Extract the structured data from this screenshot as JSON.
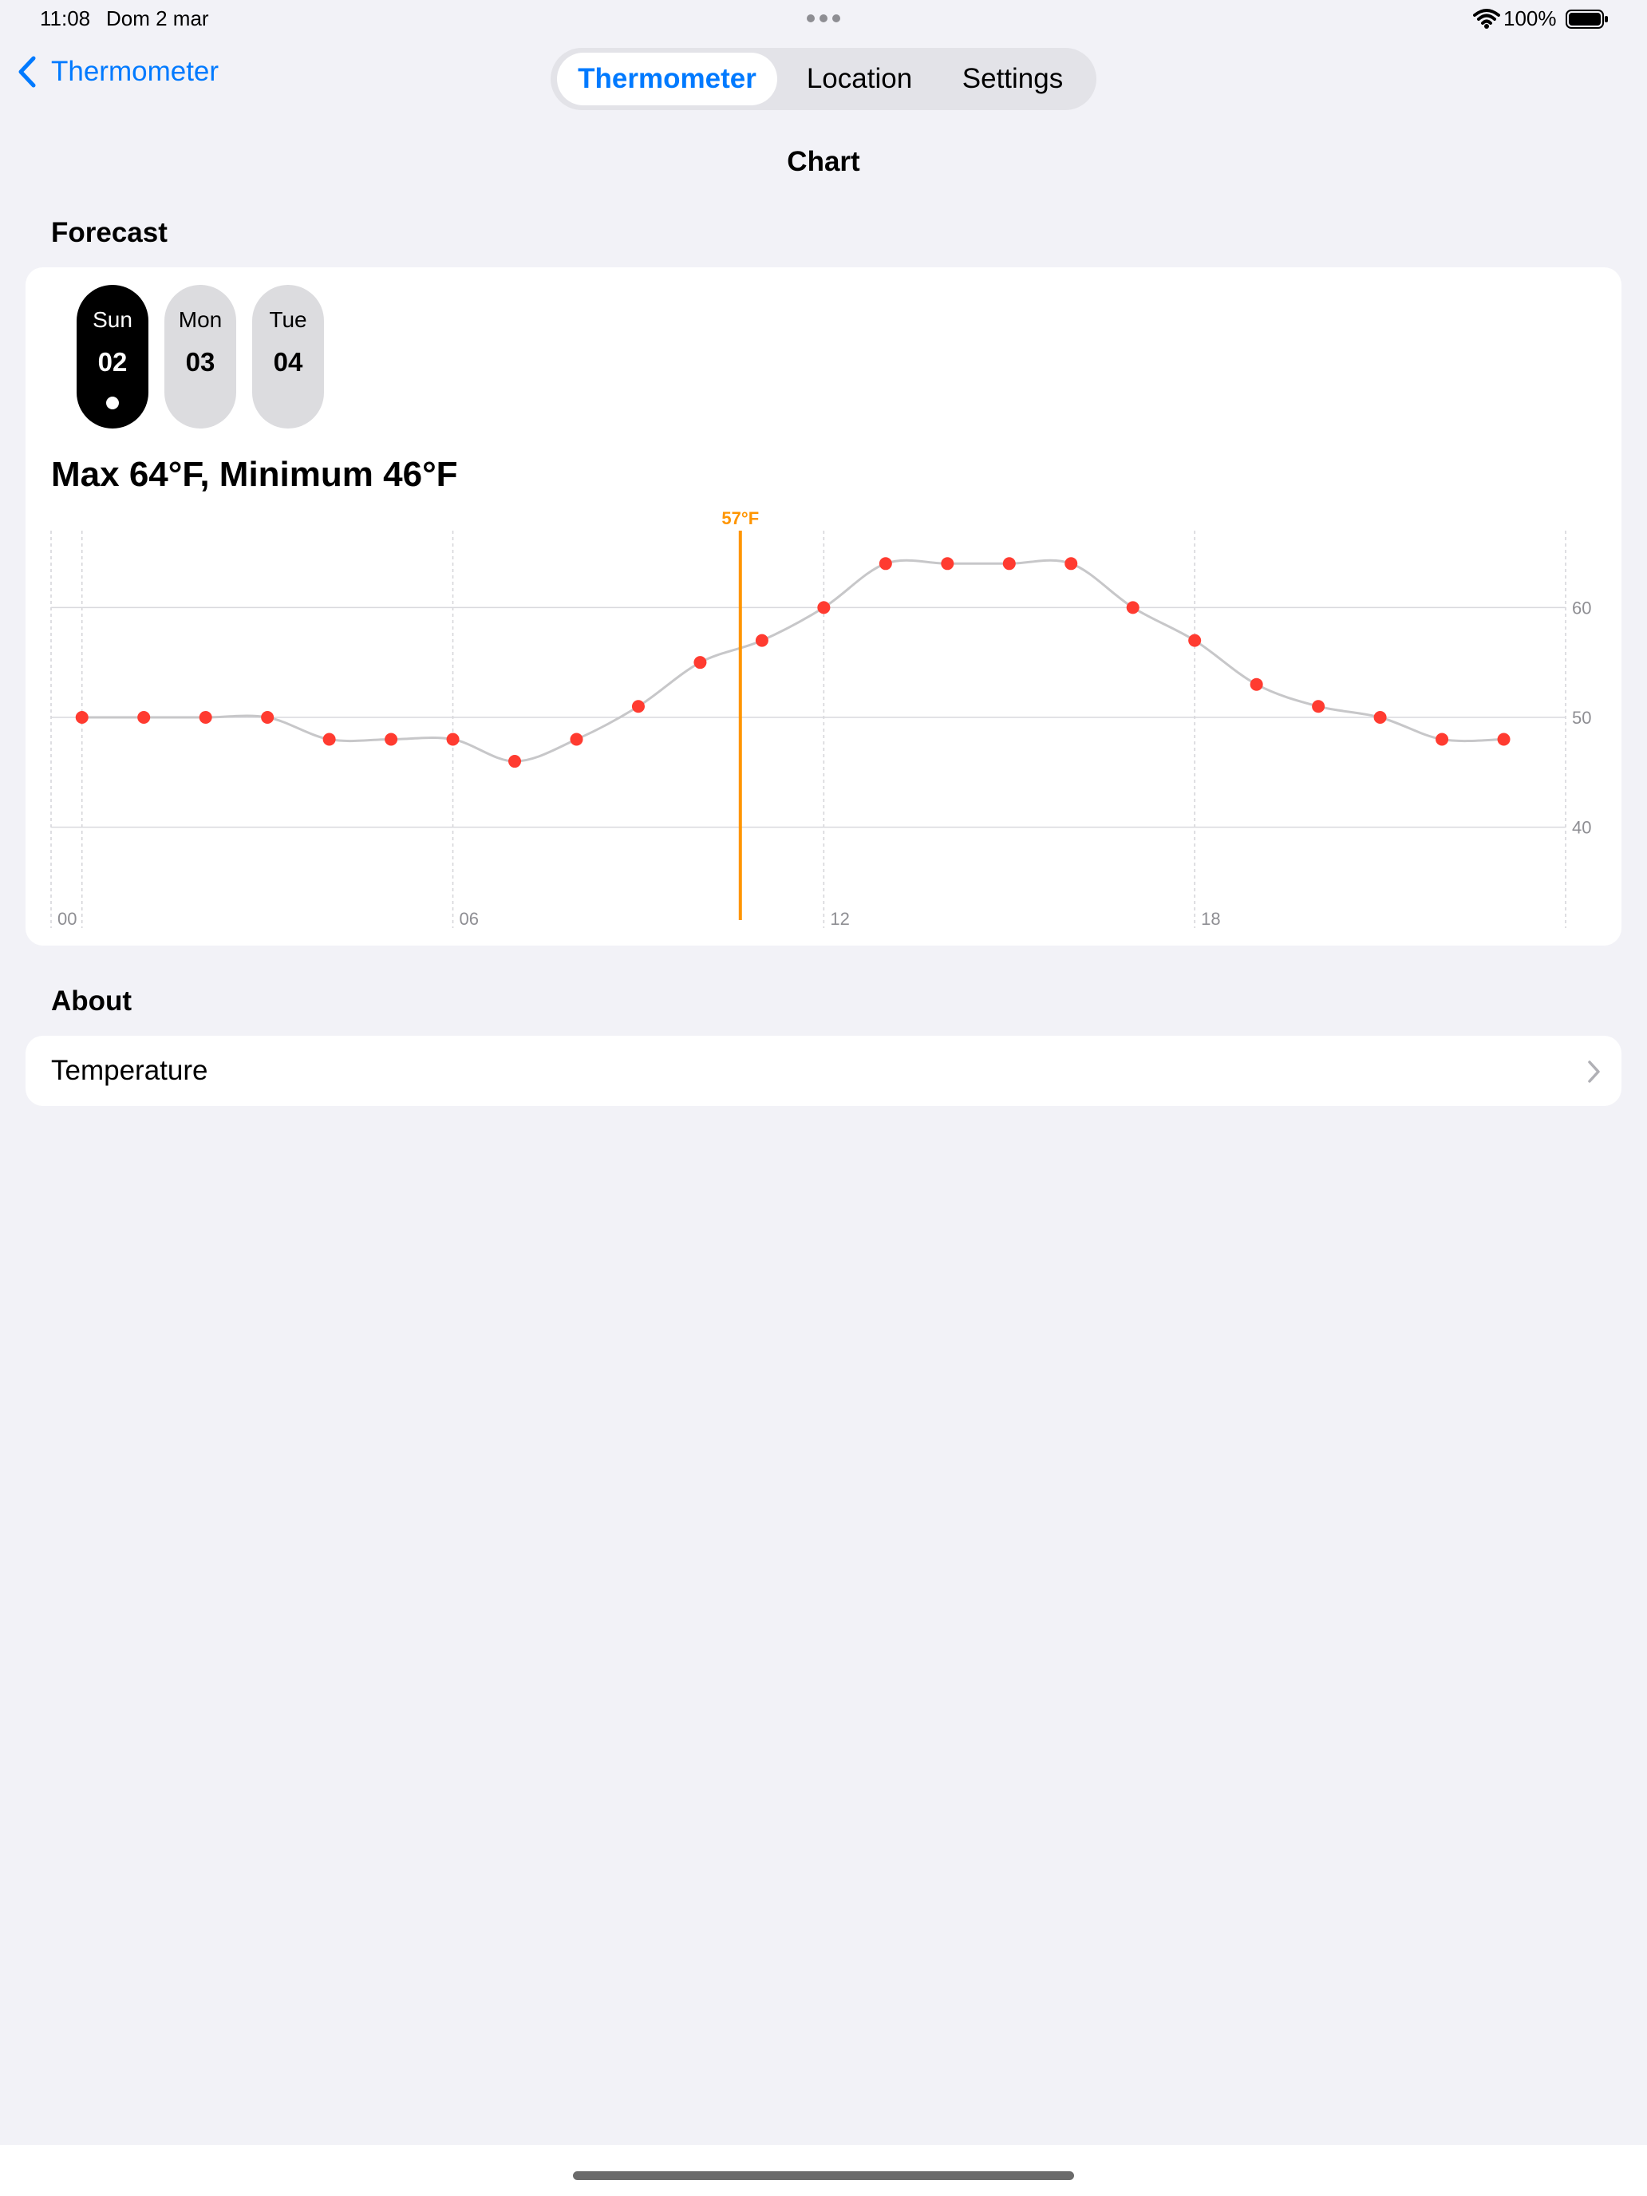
{
  "status_bar": {
    "time": "11:08",
    "date": "Dom 2 mar",
    "battery": "100%"
  },
  "nav": {
    "back_label": "Thermometer",
    "tabs": [
      {
        "label": "Thermometer",
        "selected": true
      },
      {
        "label": "Location",
        "selected": false
      },
      {
        "label": "Settings",
        "selected": false
      }
    ]
  },
  "page_title": "Chart",
  "forecast": {
    "header": "Forecast",
    "days": [
      {
        "name": "Sun",
        "num": "02",
        "selected": true
      },
      {
        "name": "Mon",
        "num": "03",
        "selected": false
      },
      {
        "name": "Tue",
        "num": "04",
        "selected": false
      }
    ],
    "summary": "Max 64°F, Minimum 46°F"
  },
  "chart_data": {
    "type": "line",
    "x": [
      0,
      1,
      2,
      3,
      4,
      5,
      6,
      7,
      8,
      9,
      10,
      11,
      12,
      13,
      14,
      15,
      16,
      17,
      18,
      19,
      20,
      21,
      22,
      23
    ],
    "series": [
      {
        "values": [
          50,
          50,
          50,
          50,
          48,
          48,
          48,
          46,
          48,
          51,
          55,
          57,
          60,
          64,
          64,
          64,
          64,
          60,
          57,
          53,
          51,
          50,
          48,
          48
        ]
      }
    ],
    "x_tick_labels": [
      "00",
      "06",
      "12",
      "18"
    ],
    "x_ticks": [
      0,
      6,
      12,
      18
    ],
    "y_tick_labels": [
      "40",
      "50",
      "60"
    ],
    "y_ticks": [
      40,
      50,
      60
    ],
    "xlim": [
      -0.5,
      24
    ],
    "ylim": [
      33,
      67
    ],
    "annotation": {
      "x": 10.65,
      "label": "57°F"
    },
    "colors": {
      "line": "#c7c7c9",
      "points": "#ff3b30",
      "annotation": "#ff9500"
    },
    "y_axis_position": "right",
    "grid": true
  },
  "about": {
    "header": "About",
    "item_label": "Temperature"
  }
}
